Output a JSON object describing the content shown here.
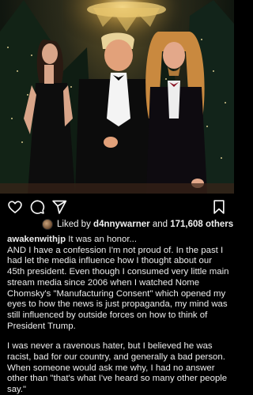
{
  "actions": {
    "like_icon": "heart-outline-icon",
    "comment_icon": "comment-bubble-icon",
    "share_icon": "paper-plane-icon",
    "save_icon": "bookmark-icon"
  },
  "likes": {
    "prefix": "Liked by",
    "user": "d4nnywarner",
    "and": "and",
    "count": "171,608 others"
  },
  "post": {
    "username": "awakenwithjp",
    "caption_intro": "It was an honor...",
    "paragraph1": "AND I have a confession I'm not proud of. In the past I had let the media influence how I thought about our 45th president. Even though I consumed very little main stream media since 2006 when I watched Nome Chomsky's \"Manufacturing Consent\" which opened my eyes to how the news is just propaganda, my mind was still influenced by outside forces on how to think of President Trump.",
    "paragraph2": "I was never a ravenous hater, but I believed he was racist, bad for our country, and generally a bad person. When someone would ask me why, I had no answer other than \"that's what I've heard so many other people say.\""
  },
  "colors": {
    "background": "#000000",
    "text": "#f5f5f5",
    "photo_backdrop": "#10160f",
    "chandelier": "#f3d27a"
  }
}
